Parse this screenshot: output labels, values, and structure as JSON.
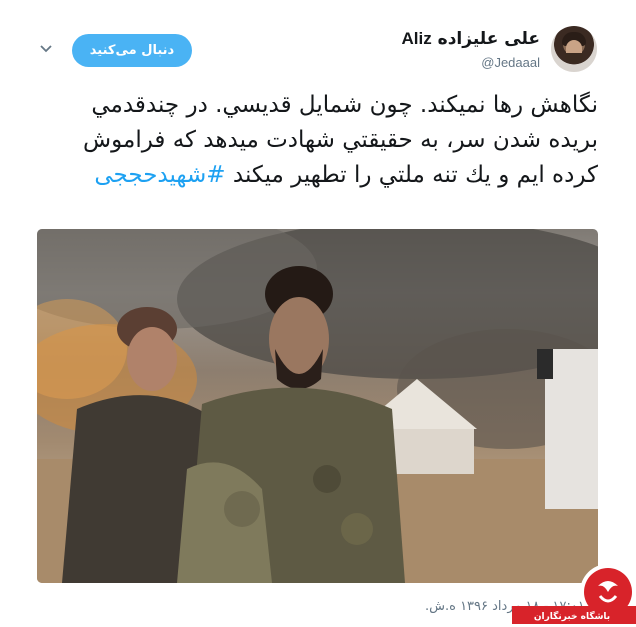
{
  "header": {
    "name_latin": "Aliz",
    "name_farsi": "علی علیزاده",
    "handle": "@Jedaaal",
    "follow_label": "دنبال می‌کنید"
  },
  "tweet": {
    "text": "نگاهش رها نميكند. چون شمايل قديسي. در چندقدمي بريده شدن سر، به حقيقتي شهادت ميدهد كه فراموش كرده ايم و يك تنه ملتي را تطهير ميكند",
    "hashtag": "#شهیدحججی",
    "timestamp": "۱۷:۰۱ - ۱۸ مرداد ۱۳۹۶ ه.ش."
  },
  "watermark": {
    "label": "باشگاه خبرنگاران"
  },
  "icons": {
    "chevron": "chevron-down-icon",
    "avatar": "avatar-photo"
  },
  "colors": {
    "accent": "#4ab3f4",
    "link": "#1da1f2",
    "text": "#14171a",
    "muted": "#657786",
    "watermark_red": "#d8232a"
  }
}
